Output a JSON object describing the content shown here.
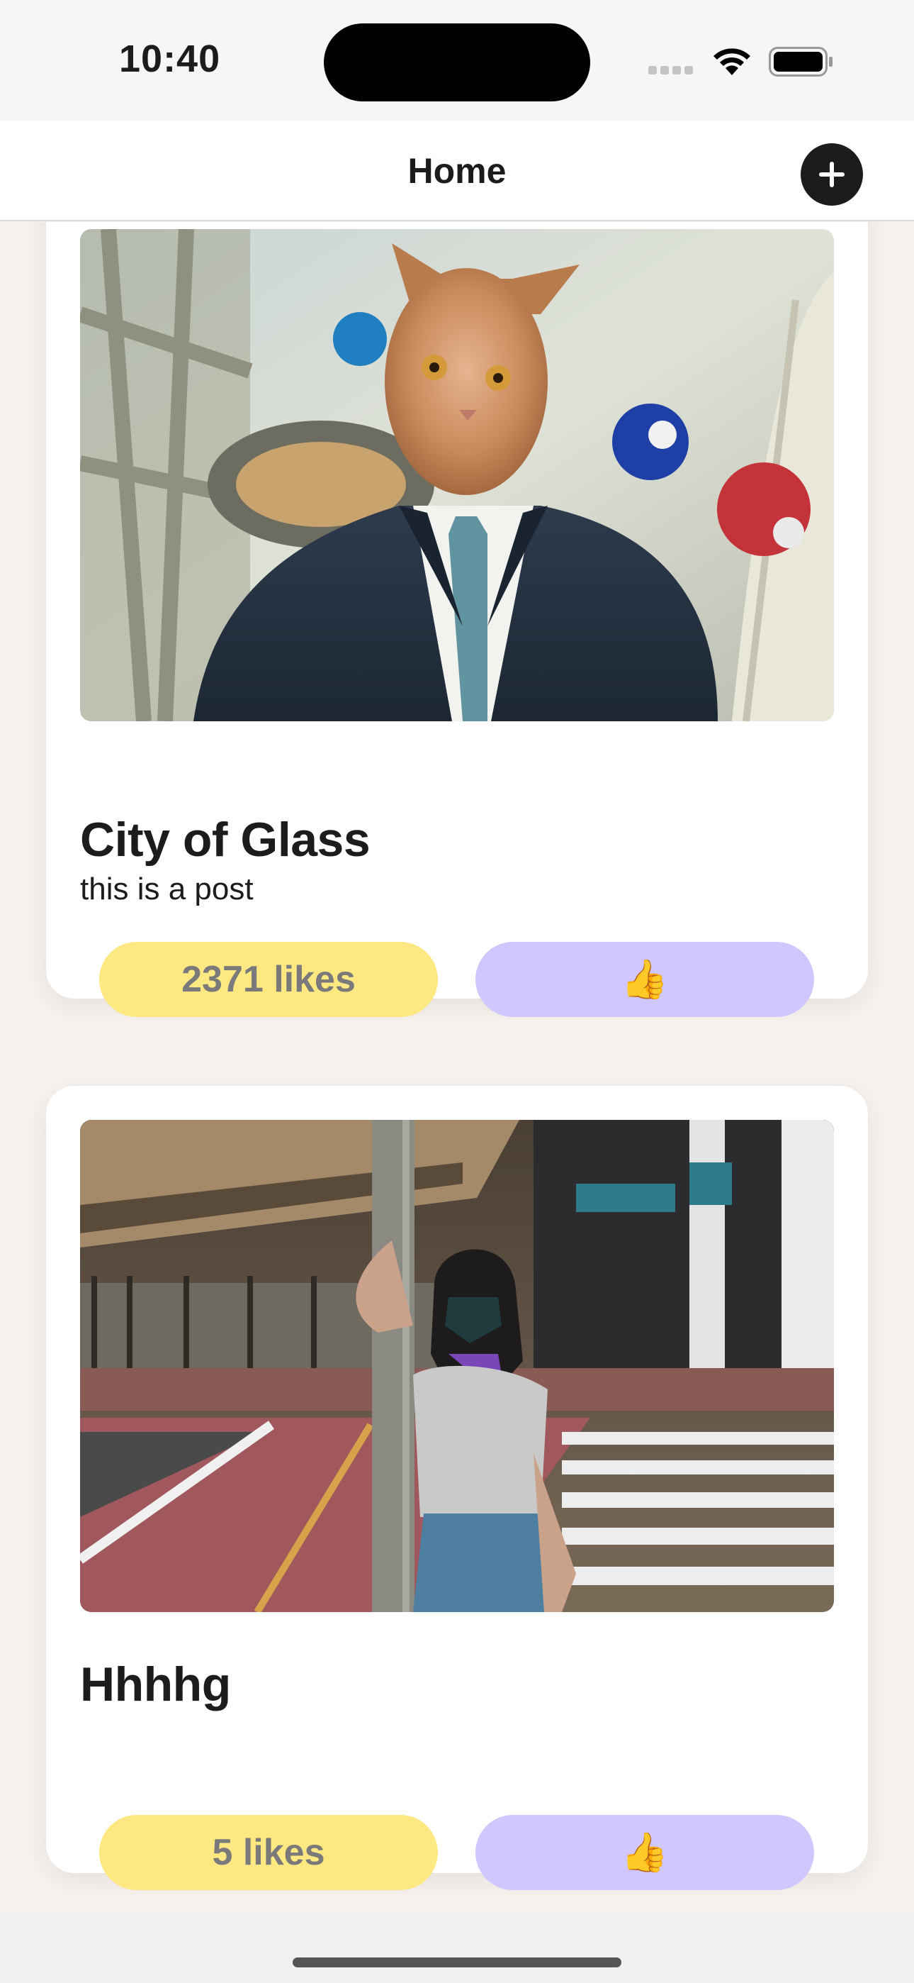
{
  "status_bar": {
    "time": "10:40"
  },
  "nav": {
    "title": "Home",
    "add_icon": "plus-icon"
  },
  "posts": [
    {
      "title": "City of Glass",
      "body": "this is a post",
      "likes_label": "2371 likes",
      "like_button": "👍",
      "image": "cat-head-in-business-suit-photo"
    },
    {
      "title": "Hhhhg",
      "body": "",
      "likes_label": "5 likes",
      "like_button": "👍",
      "image": "woman-leaning-on-pole-street-photo"
    }
  ],
  "colors": {
    "likes_pill": "#fde882",
    "like_button": "#cfc7fe",
    "background": "#f7f2ee"
  }
}
